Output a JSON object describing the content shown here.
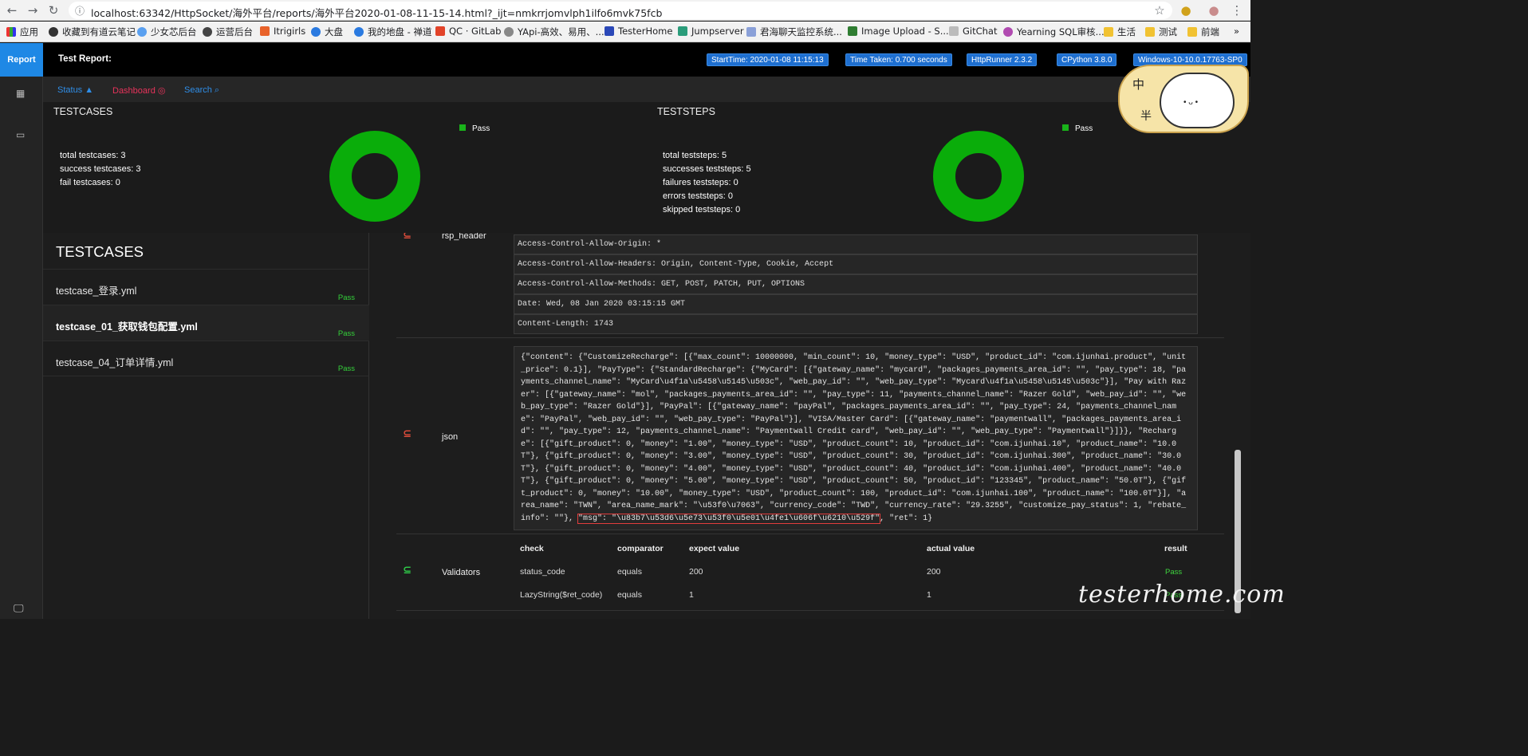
{
  "browser": {
    "url": "localhost:63342/HttpSocket/海外平台/reports/海外平台2020-01-08-11-15-14.html?_ijt=nmkrrjomvlph1ilfo6mvk75fcb",
    "bookmarks": [
      "应用",
      "收藏到有道云笔记",
      "少女芯后台",
      "运营后台",
      "Itrigirls",
      "大盘",
      "我的地盘 - 禅道",
      "QC · GitLab",
      "YApi-高效、易用、...",
      "TesterHome",
      "Jumpserver",
      "君海聊天监控系统...",
      "Image Upload - S...",
      "GitChat",
      "Yearning SQL审核...",
      "生活",
      "测试",
      "前端"
    ]
  },
  "header": {
    "report_tab": "Report",
    "title": "Test Report:",
    "badges": [
      "StartTime: 2020-01-08 11:15:13",
      "Time Taken: 0.700 seconds",
      "HttpRunner 2.3.2",
      "CPython 3.8.0",
      "Windows-10-10.0.17763-SP0"
    ]
  },
  "subnav": {
    "status": "Status",
    "dashboard": "Dashboard",
    "search": "Search"
  },
  "dashboard": {
    "testcases": {
      "title": "TESTCASES",
      "stats": [
        "total testcases: 3",
        "success testcases: 3",
        "fail testcases: 0"
      ],
      "legend": "Pass"
    },
    "teststeps": {
      "title": "TESTSTEPS",
      "stats": [
        "total teststeps: 5",
        "successes teststeps: 5",
        "failures teststeps: 0",
        "errors teststeps: 0",
        "skipped teststeps: 0"
      ],
      "legend": "Pass"
    },
    "colors": {
      "pass": "#0aad0a"
    }
  },
  "testcases_panel": {
    "heading": "TESTCASES",
    "items": [
      {
        "name": "testcase_登录.yml",
        "status": "Pass"
      },
      {
        "name": "testcase_01_获取钱包配置.yml",
        "status": "Pass"
      },
      {
        "name": "testcase_04_订单详情.yml",
        "status": "Pass"
      }
    ]
  },
  "detail": {
    "rsp_header_label": "rsp_header",
    "headers": [
      "Access-Control-Allow-Origin: *",
      "Access-Control-Allow-Headers: Origin, Content-Type, Cookie, Accept",
      "Access-Control-Allow-Methods: GET, POST, PATCH, PUT, OPTIONS",
      "Date: Wed, 08 Jan 2020 03:15:15 GMT",
      "Content-Length: 1743"
    ],
    "json_label": "json",
    "json_body": "{\"content\": {\"CustomizeRecharge\": [{\"max_count\": 10000000, \"min_count\": 10, \"money_type\": \"USD\", \"product_id\": \"com.ijunhai.product\", \"unit_price\": 0.1}], \"PayType\": {\"StandardRecharge\": {\"MyCard\": [{\"gateway_name\": \"mycard\", \"packages_payments_area_id\": \"\", \"pay_type\": 18, \"payments_channel_name\": \"MyCard\\u4f1a\\u5458\\u5145\\u503c\", \"web_pay_id\": \"\", \"web_pay_type\": \"Mycard\\u4f1a\\u5458\\u5145\\u503c\"}], \"Pay with Razer\": [{\"gateway_name\": \"mol\", \"packages_payments_area_id\": \"\", \"pay_type\": 11, \"payments_channel_name\": \"Razer Gold\", \"web_pay_id\": \"\", \"web_pay_type\": \"Razer Gold\"}], \"PayPal\": [{\"gateway_name\": \"payPal\", \"packages_payments_area_id\": \"\", \"pay_type\": 24, \"payments_channel_name\": \"PayPal\", \"web_pay_id\": \"\", \"web_pay_type\": \"PayPal\"}], \"VISA/Master Card\": [{\"gateway_name\": \"paymentwall\", \"packages_payments_area_id\": \"\", \"pay_type\": 12, \"payments_channel_name\": \"Paymentwall Credit card\", \"web_pay_id\": \"\", \"web_pay_type\": \"Paymentwall\"}]}}, \"Recharge\": [{\"gift_product\": 0, \"money\": \"1.00\", \"money_type\": \"USD\", \"product_count\": 10, \"product_id\": \"com.ijunhai.10\", \"product_name\": \"10.0T\"}, {\"gift_product\": 0, \"money\": \"3.00\", \"money_type\": \"USD\", \"product_count\": 30, \"product_id\": \"com.ijunhai.300\", \"product_name\": \"30.0T\"}, {\"gift_product\": 0, \"money\": \"4.00\", \"money_type\": \"USD\", \"product_count\": 40, \"product_id\": \"com.ijunhai.400\", \"product_name\": \"40.0T\"}, {\"gift_product\": 0, \"money\": \"5.00\", \"money_type\": \"USD\", \"product_count\": 50, \"product_id\": \"123345\", \"product_name\": \"50.0T\"}, {\"gift_product\": 0, \"money\": \"10.00\", \"money_type\": \"USD\", \"product_count\": 100, \"product_id\": \"com.ijunhai.100\", \"product_name\": \"100.0T\"}], \"area_name\": \"TWN\", \"area_name_mark\": \"\\u53f0\\u7063\", \"currency_code\": \"TWD\", \"currency_rate\": \"29.3255\", \"customize_pay_status\": 1, \"rebate_info\": \"\"}, ",
    "json_msg": "\"msg\": \"\\u83b7\\u53d6\\u5e73\\u53f0\\u5e01\\u4fe1\\u606f\\u6210\\u529f\"",
    "json_tail": ", \"ret\": 1}",
    "validators_label": "Validators",
    "validator_columns": [
      "check",
      "comparator",
      "expect value",
      "actual value",
      "result"
    ],
    "validators": [
      {
        "check": "status_code",
        "comparator": "equals",
        "expect": "200",
        "actual": "200",
        "result": "Pass"
      },
      {
        "check": "LazyString($ret_code)",
        "comparator": "equals",
        "expect": "1",
        "actual": "1",
        "result": "Pass"
      }
    ]
  },
  "watermark": "testerhome.com",
  "badge_chars": [
    "中",
    "半"
  ]
}
